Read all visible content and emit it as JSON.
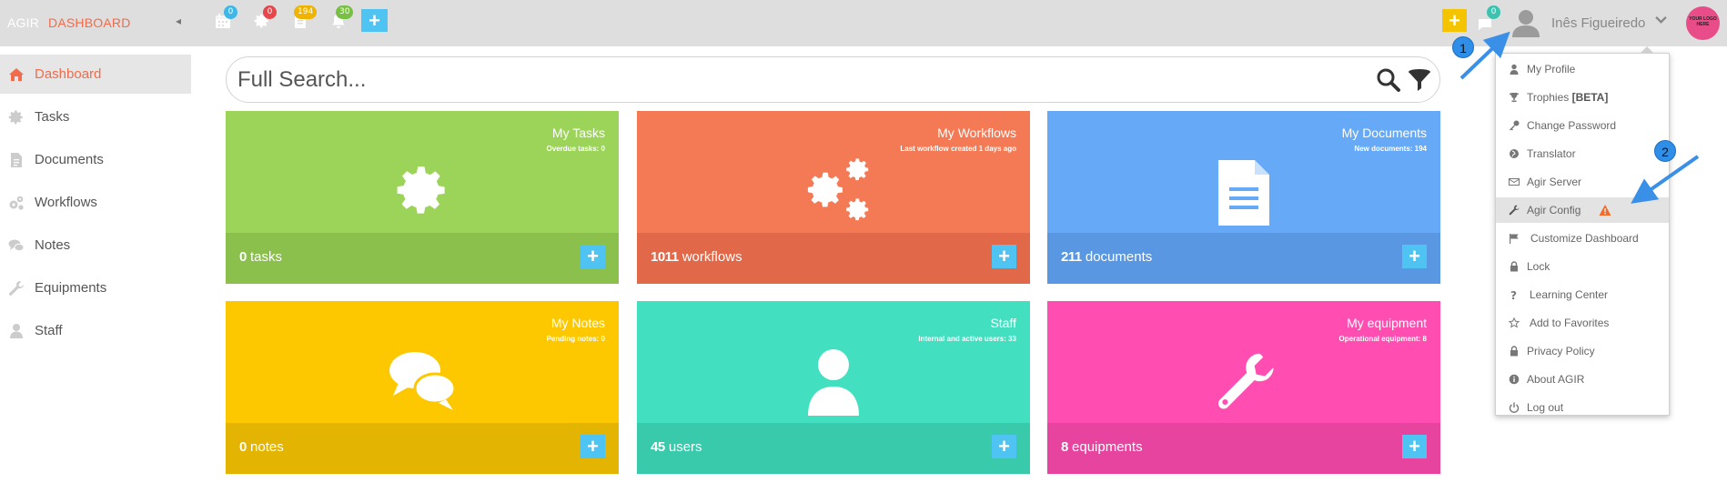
{
  "header": {
    "brand_left": "AGIR",
    "brand_right": "DASHBOARD",
    "collapse_glyph": "◂",
    "badges": {
      "calendar": "0",
      "settings": "0",
      "documents": "194",
      "notifications": "30",
      "messages": "0"
    },
    "add_glyph": "+",
    "user_name": "Inês Figueiredo",
    "user_chevron": "⌄",
    "logo_text": "YOUR LOGO HERE",
    "colors": {
      "calendar_badge": "#3fb6e8",
      "settings_badge": "#e8464a",
      "documents_badge": "#f0b400",
      "notifications_badge": "#78c043",
      "messages_badge": "#3cc2b0",
      "add_blue": "#4fc3f2",
      "add_yellow": "#f5c400"
    }
  },
  "sidebar": {
    "items": [
      {
        "label": "Dashboard",
        "icon": "home-icon"
      },
      {
        "label": "Tasks",
        "icon": "gear-icon"
      },
      {
        "label": "Documents",
        "icon": "document-icon"
      },
      {
        "label": "Workflows",
        "icon": "gears-icon"
      },
      {
        "label": "Notes",
        "icon": "comments-icon"
      },
      {
        "label": "Equipments",
        "icon": "wrench-icon"
      },
      {
        "label": "Staff",
        "icon": "user-icon"
      }
    ]
  },
  "search": {
    "placeholder": "Full Search..."
  },
  "cards": [
    {
      "title": "My Tasks",
      "subtitle": "Overdue tasks: 0",
      "count": "0",
      "unit": "tasks",
      "icon": "gear-icon",
      "color_top": "#9cd45a",
      "color_bottom": "#8bc04c"
    },
    {
      "title": "My Workflows",
      "subtitle": "Last workflow created 1 days ago",
      "count": "1011",
      "unit": "workflows",
      "icon": "gears-icon",
      "color_top": "#f47a55",
      "color_bottom": "#e1694a"
    },
    {
      "title": "My Documents",
      "subtitle": "New documents: 194",
      "count": "211",
      "unit": "documents",
      "icon": "document-icon",
      "color_top": "#66a9f7",
      "color_bottom": "#5a97e2"
    },
    {
      "title": "My Notes",
      "subtitle": "Pending notes: 0",
      "count": "0",
      "unit": "notes",
      "icon": "comments-icon",
      "color_top": "#fdc800",
      "color_bottom": "#e3b402"
    },
    {
      "title": "Staff",
      "subtitle": "Internal and active users: 33",
      "count": "45",
      "unit": "users",
      "icon": "user-icon",
      "color_top": "#42e0c0",
      "color_bottom": "#39c9ab"
    },
    {
      "title": "My equipment",
      "subtitle": "Operational equipment: 8",
      "count": "8",
      "unit": "equipments",
      "icon": "wrench-icon",
      "color_top": "#ff4db1",
      "color_bottom": "#e6449f"
    }
  ],
  "user_menu": {
    "items": [
      {
        "label": "My Profile",
        "icon": "user-icon"
      },
      {
        "label": "Trophies ",
        "suffix": "[BETA]",
        "icon": "trophy-icon"
      },
      {
        "label": "Change Password",
        "icon": "key-icon"
      },
      {
        "label": "Translator",
        "icon": "globe-icon"
      },
      {
        "label": "Agir Server",
        "icon": "server-icon"
      },
      {
        "label": "Agir Config",
        "icon": "wrench-icon",
        "warning": true
      },
      {
        "label": "Customize Dashboard",
        "icon": "flag-icon"
      },
      {
        "label": "Lock",
        "icon": "lock-icon"
      },
      {
        "label": "Learning Center",
        "icon": "question-icon"
      },
      {
        "label": "Add to Favorites",
        "icon": "star-icon"
      },
      {
        "label": "Privacy Policy",
        "icon": "lock-icon"
      },
      {
        "label": "About AGIR",
        "icon": "info-icon"
      },
      {
        "label": "Log out",
        "icon": "power-icon"
      }
    ]
  },
  "annotations": {
    "step1": "1",
    "step2": "2"
  }
}
